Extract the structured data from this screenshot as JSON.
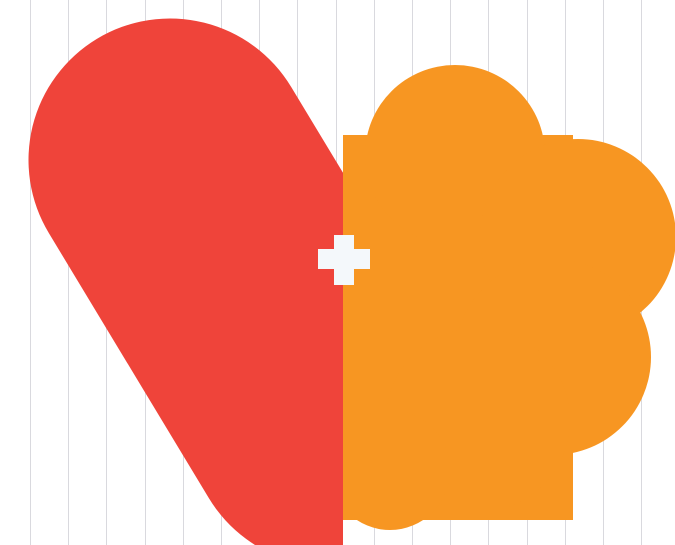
{
  "artwork": {
    "description_name": "heart-cloud-logo",
    "colors": {
      "background": "#ffffff",
      "grid_line": "#d9d9de",
      "heart_half": "#ef443a",
      "cloud_half": "#f79622",
      "plus_sign": "#f4f8fb"
    },
    "icons": [
      "half-heart-icon",
      "cloud-icon",
      "plus-icon"
    ]
  }
}
